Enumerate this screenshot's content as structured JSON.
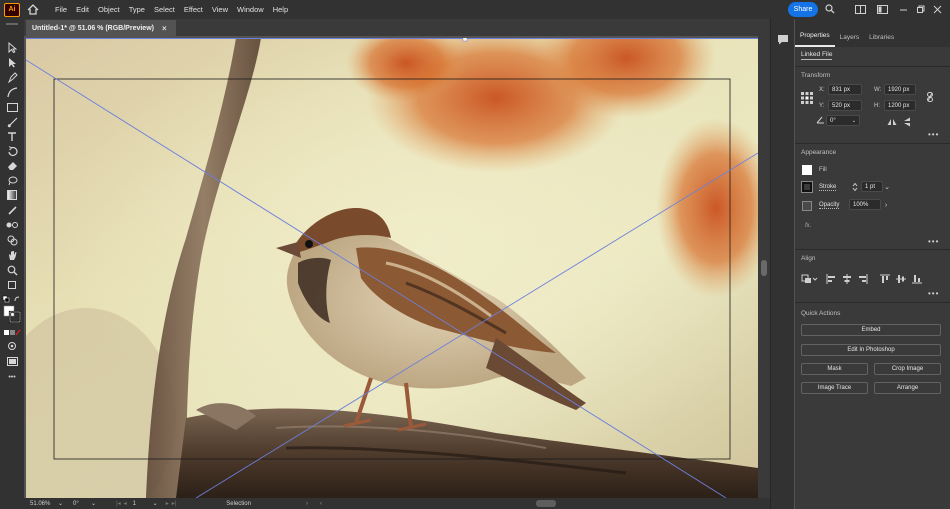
{
  "app": {
    "logo_text": "Ai"
  },
  "menu": [
    "File",
    "Edit",
    "Object",
    "Type",
    "Select",
    "Effect",
    "View",
    "Window",
    "Help"
  ],
  "toolbar_right": {
    "share_label": "Share"
  },
  "document_tab": {
    "title": "Untitled-1* @ 51.06 % (RGB/Preview)",
    "close": "×"
  },
  "panel": {
    "tabs": [
      "Properties",
      "Layers",
      "Libraries"
    ],
    "linked_file": "Linked File",
    "transform": {
      "title": "Transform",
      "x_label": "X:",
      "x_value": "831 px",
      "y_label": "Y:",
      "y_value": "520 px",
      "w_label": "W:",
      "w_value": "1920 px",
      "h_label": "H:",
      "h_value": "1200 px",
      "angle_value": "0°"
    },
    "appearance": {
      "title": "Appearance",
      "fill_label": "Fill",
      "stroke_label": "Stroke",
      "stroke_value": "1 pt",
      "opacity_label": "Opacity",
      "opacity_value": "100%",
      "fx_label": "fx."
    },
    "align": {
      "title": "Align"
    },
    "quick_actions": {
      "title": "Quick Actions",
      "embed": "Embed",
      "edit_in_photoshop": "Edit In Photoshop",
      "mask": "Mask",
      "crop_image": "Crop Image",
      "image_trace": "Image Trace",
      "arrange": "Arrange"
    },
    "more": "•••"
  },
  "statusbar": {
    "zoom": "51.06%",
    "rotation": "0°",
    "artboard": "1",
    "tool": "Selection"
  },
  "toolbar_more": "•••",
  "colors": {
    "accent": "#1473e6",
    "ui_dark": "#323232",
    "ui_mid": "#3a3a3a",
    "ui_canvas": "#535353",
    "selection_line": "#6b7fdc"
  }
}
